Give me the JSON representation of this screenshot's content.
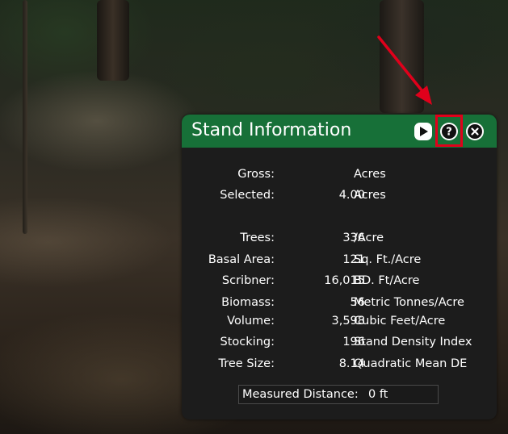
{
  "panel": {
    "title": "Stand Information",
    "buttons": {
      "play_icon": "play-icon",
      "help_icon": "help-icon",
      "close_icon": "close-icon"
    },
    "help_glyph": "?",
    "colors": {
      "title_bar": "#177038",
      "panel_bg": "#1c1c1c",
      "highlight": "#e0001b",
      "arrow": "#e0001b"
    }
  },
  "rows": [
    {
      "label": "Gross:",
      "value": "",
      "unit": "Acres"
    },
    {
      "label": "Selected:",
      "value": "4.00",
      "unit": "Acres"
    },
    {
      "label": "Trees:",
      "value": "336",
      "unit": "/Acre"
    },
    {
      "label": "Basal Area:",
      "value": "121",
      "unit": "Sq. Ft./Acre"
    },
    {
      "label": "Scribner:",
      "value": "16,015",
      "unit": "BD. Ft/Acre"
    },
    {
      "label": "Biomass:",
      "value": "56",
      "unit": "Metric Tonnes/Acre"
    },
    {
      "label": "Volume:",
      "value": "3,598",
      "unit": "Cubic Feet/Acre"
    },
    {
      "label": "Stocking:",
      "value": "196",
      "unit": "Stand Density Index"
    },
    {
      "label": "Tree Size:",
      "value": "8.14",
      "unit": "Quadratic Mean DE"
    }
  ],
  "measured": {
    "label": "Measured Distance:",
    "value": "0 ft"
  }
}
